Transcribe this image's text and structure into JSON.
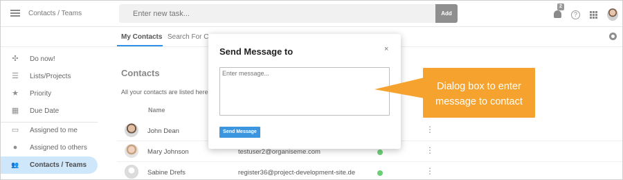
{
  "header": {
    "breadcrumb": "Contacts / Teams",
    "task_placeholder": "Enter new task...",
    "add_label": "Add",
    "notification_count": "2",
    "help_glyph": "?",
    "icons": [
      "menu-icon",
      "bell-icon",
      "help-icon",
      "apps-grid-icon"
    ]
  },
  "tabs": [
    {
      "label": "My Contacts",
      "active": true
    },
    {
      "label": "Search For Co",
      "active": false
    }
  ],
  "sidebar": {
    "items": [
      {
        "label": "Do now!",
        "icon": "tasks-cluster-icon",
        "glyph": "✣"
      },
      {
        "label": "Lists/Projects",
        "icon": "list-icon",
        "glyph": "☰"
      },
      {
        "label": "Priority",
        "icon": "star-icon",
        "glyph": "★"
      },
      {
        "label": "Due Date",
        "icon": "calendar-icon",
        "glyph": "▦"
      },
      {
        "label": "Assigned to me",
        "icon": "inbox-icon",
        "glyph": "▭"
      },
      {
        "label": "Assigned to others",
        "icon": "person-icon",
        "glyph": "●"
      },
      {
        "label": "Contacts / Teams",
        "icon": "people-icon",
        "glyph": "👥",
        "active": true
      }
    ],
    "active_color": "#cfe7fb"
  },
  "main": {
    "title": "Contacts",
    "subtitle": "All your contacts are listed here",
    "column_name": "Name",
    "rows": [
      {
        "name": "John Dean",
        "email": "",
        "status": "online"
      },
      {
        "name": "Mary Johnson",
        "email": "testuser2@organiseme.com",
        "status": "online"
      },
      {
        "name": "Sabine Drefs",
        "email": "register36@project-development-site.de",
        "status": "online"
      }
    ],
    "status_color": "#6ccf78",
    "more_glyph": "⋮"
  },
  "modal": {
    "title": "Send Message to",
    "close_glyph": "×",
    "message_placeholder": "Enter message...",
    "send_label": "Send Message",
    "accent": "#3b95df"
  },
  "callout": {
    "line1": "Dialog box to enter",
    "line2": "message to contact",
    "color": "#f5a32e"
  }
}
